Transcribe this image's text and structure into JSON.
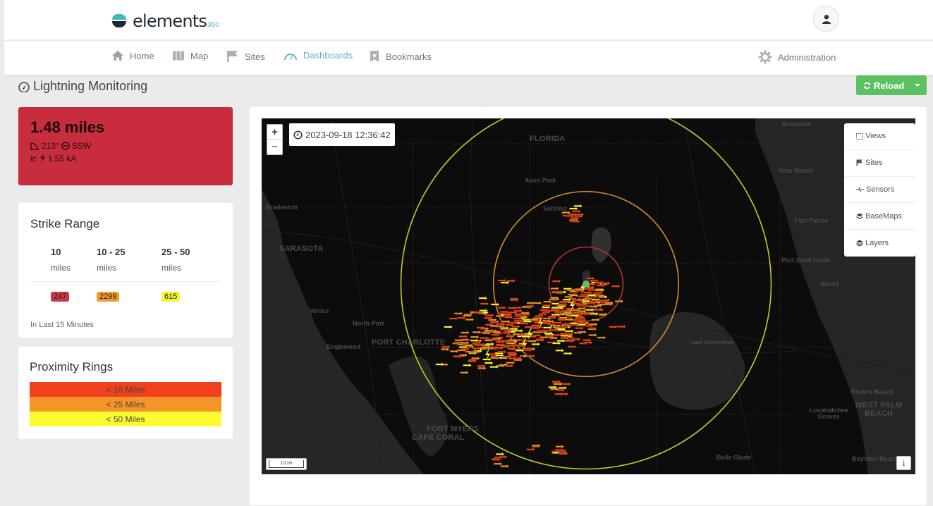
{
  "app": {
    "logo_text": "elements",
    "logo_sup": "360",
    "user_icon": "user-icon"
  },
  "nav": {
    "items": [
      {
        "label": "Home",
        "icon": "home-icon",
        "active": false
      },
      {
        "label": "Map",
        "icon": "map-icon",
        "active": false
      },
      {
        "label": "Sites",
        "icon": "flag-icon",
        "active": false
      },
      {
        "label": "Dashboards",
        "icon": "dashboard-gauge-icon",
        "active": true
      },
      {
        "label": "Bookmarks",
        "icon": "bookmark-icon",
        "active": false
      }
    ],
    "admin": {
      "label": "Administration",
      "icon": "gear-icon"
    }
  },
  "page": {
    "title": "Lightning Monitoring",
    "reload_label": "Reload"
  },
  "alert": {
    "distance": "1.48 miles",
    "bearing": "213°",
    "direction": "SSW",
    "strike_type": "ic",
    "current": "1.55 kA",
    "color": "#c82d3e"
  },
  "strike_range": {
    "title": "Strike Range",
    "columns": [
      {
        "range": "10",
        "unit": "miles",
        "count": "247",
        "color": "#d03545"
      },
      {
        "range": "10 - 25",
        "unit": "miles",
        "count": "2299",
        "color": "#f59b2b"
      },
      {
        "range": "25 - 50",
        "unit": "miles",
        "count": "615",
        "color": "#f5f532"
      }
    ],
    "footer": "In Last 15 Minutes"
  },
  "proximity": {
    "title": "Proximity Rings",
    "rings": [
      {
        "label": "< 10 Miles",
        "color": "#f0401e"
      },
      {
        "label": "< 25 Miles",
        "color": "#f59527"
      },
      {
        "label": "< 50 Miles",
        "color": "#fbfb2f"
      }
    ]
  },
  "map": {
    "timestamp": "2023-09-18 12:36:42",
    "zoom_in": "+",
    "zoom_out": "−",
    "scale": "10 mi",
    "info": "i",
    "layers_menu": [
      {
        "label": "Views",
        "icon": "selection-icon"
      },
      {
        "label": "Sites",
        "icon": "flag-icon"
      },
      {
        "label": "Sensors",
        "icon": "sensor-pulse-icon"
      },
      {
        "label": "BaseMaps",
        "icon": "stack-icon"
      },
      {
        "label": "Layers",
        "icon": "layers-icon"
      }
    ],
    "place_labels": [
      {
        "text": "FLORIDA",
        "big": true
      },
      {
        "text": "Sebastian",
        "big": false
      },
      {
        "text": "Avon Park",
        "big": false
      },
      {
        "text": "Vero Beach",
        "big": false
      },
      {
        "text": "Sebring",
        "big": false
      },
      {
        "text": "Bradenton",
        "big": false
      },
      {
        "text": "Fort Pierce",
        "big": false
      },
      {
        "text": "SARASOTA",
        "big": true
      },
      {
        "text": "Port Saint Lucie",
        "big": false
      },
      {
        "text": "Stuart",
        "big": false
      },
      {
        "text": "Venice",
        "big": false
      },
      {
        "text": "North Port",
        "big": false
      },
      {
        "text": "PORT CHARLOTTE",
        "big": true
      },
      {
        "text": "Englewood",
        "big": false
      },
      {
        "text": "Lake Okeechobee",
        "big": false
      },
      {
        "text": "Riviera Beach",
        "big": false
      },
      {
        "text": "WEST PALM BEACH",
        "big": true
      },
      {
        "text": "Loxahatchee Groves",
        "big": false
      },
      {
        "text": "Belle Glade",
        "big": false
      },
      {
        "text": "FORT MYERS",
        "big": true
      },
      {
        "text": "CAPE CORAL",
        "big": true
      },
      {
        "text": "Boynton Beach",
        "big": false
      }
    ],
    "rings": [
      {
        "radius_miles": 10,
        "color": "#b8322c"
      },
      {
        "radius_miles": 25,
        "color": "#d98a2a"
      },
      {
        "radius_miles": 50,
        "color": "#c9c92a"
      }
    ],
    "site_color": "#5fbf6a"
  }
}
